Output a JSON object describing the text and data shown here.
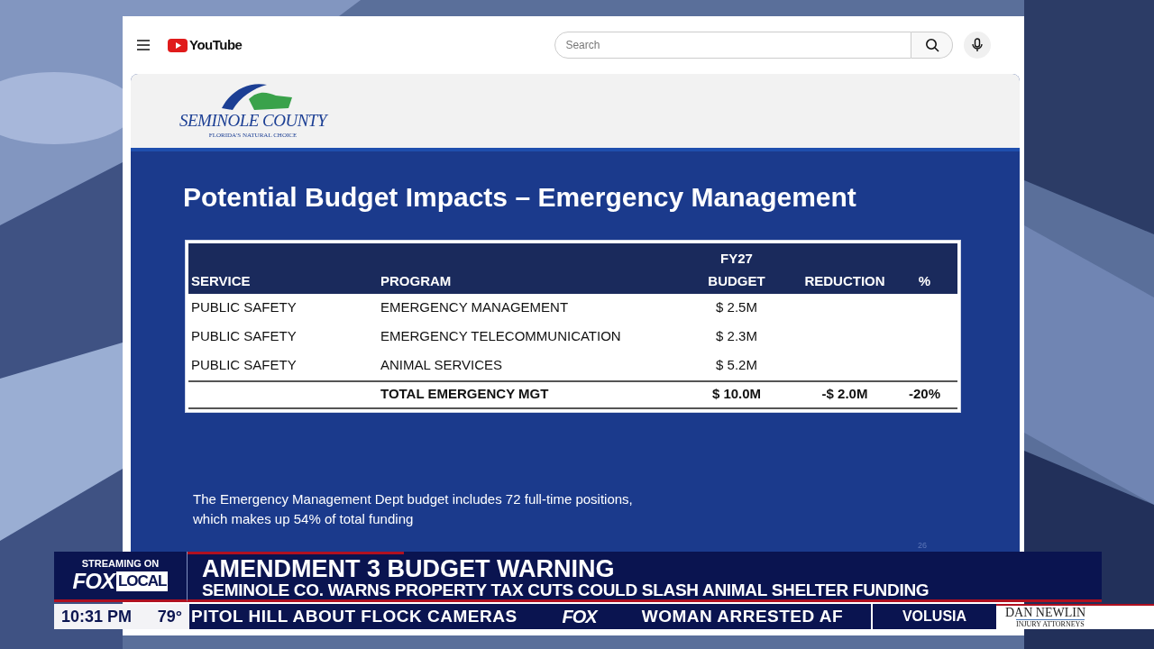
{
  "youtube": {
    "logo": "YouTube",
    "search": {
      "placeholder": "Search"
    }
  },
  "slide": {
    "org_name": "SEMINOLE COUNTY",
    "org_tagline": "FLORIDA'S NATURAL CHOICE",
    "title": "Potential Budget Impacts – Emergency Management",
    "table": {
      "columns": [
        {
          "lines": [
            "SERVICE"
          ]
        },
        {
          "lines": [
            "PROGRAM"
          ]
        },
        {
          "lines": [
            "FY27",
            "BUDGET"
          ]
        },
        {
          "lines": [
            "REDUCTION"
          ]
        },
        {
          "lines": [
            "%"
          ]
        }
      ],
      "rows": [
        {
          "kind": "item",
          "cells": [
            "PUBLIC SAFETY",
            "EMERGENCY MANAGEMENT",
            "$ 2.5M",
            "",
            ""
          ]
        },
        {
          "kind": "item",
          "cells": [
            "PUBLIC SAFETY",
            "EMERGENCY TELECOMMUNICATION",
            "$ 2.3M",
            "",
            ""
          ]
        },
        {
          "kind": "item",
          "cells": [
            "PUBLIC SAFETY",
            "ANIMAL SERVICES",
            "$ 5.2M",
            "",
            ""
          ]
        },
        {
          "kind": "total",
          "cells": [
            "",
            "TOTAL EMERGENCY MGT",
            "$ 10.0M",
            "-$ 2.0M",
            "-20%"
          ]
        }
      ]
    },
    "note": [
      "The Emergency Management Dept budget includes 72 full-time positions,",
      "which makes up 54% of total funding"
    ],
    "page_number": "26"
  },
  "chyron": {
    "badge_top": "STREAMING ON",
    "badge_fox": "FOX",
    "badge_local": "LOCAL",
    "headline": "AMENDMENT 3 BUDGET WARNING",
    "subhead": "SEMINOLE CO. WARNS PROPERTY TAX CUTS COULD SLASH ANIMAL SHELTER FUNDING",
    "time": "10:31 PM",
    "temperature": "79°",
    "ticker": [
      {
        "kind": "story",
        "text": "PITOL HILL ABOUT FLOCK CAMERAS"
      },
      {
        "kind": "logo",
        "text": "FOX"
      },
      {
        "kind": "story",
        "text": "WOMAN ARRESTED AF"
      }
    ],
    "region": "VOLUSIA",
    "sponsor": {
      "name": "DAN NEWLIN",
      "tagline": "INJURY ATTORNEYS"
    }
  }
}
